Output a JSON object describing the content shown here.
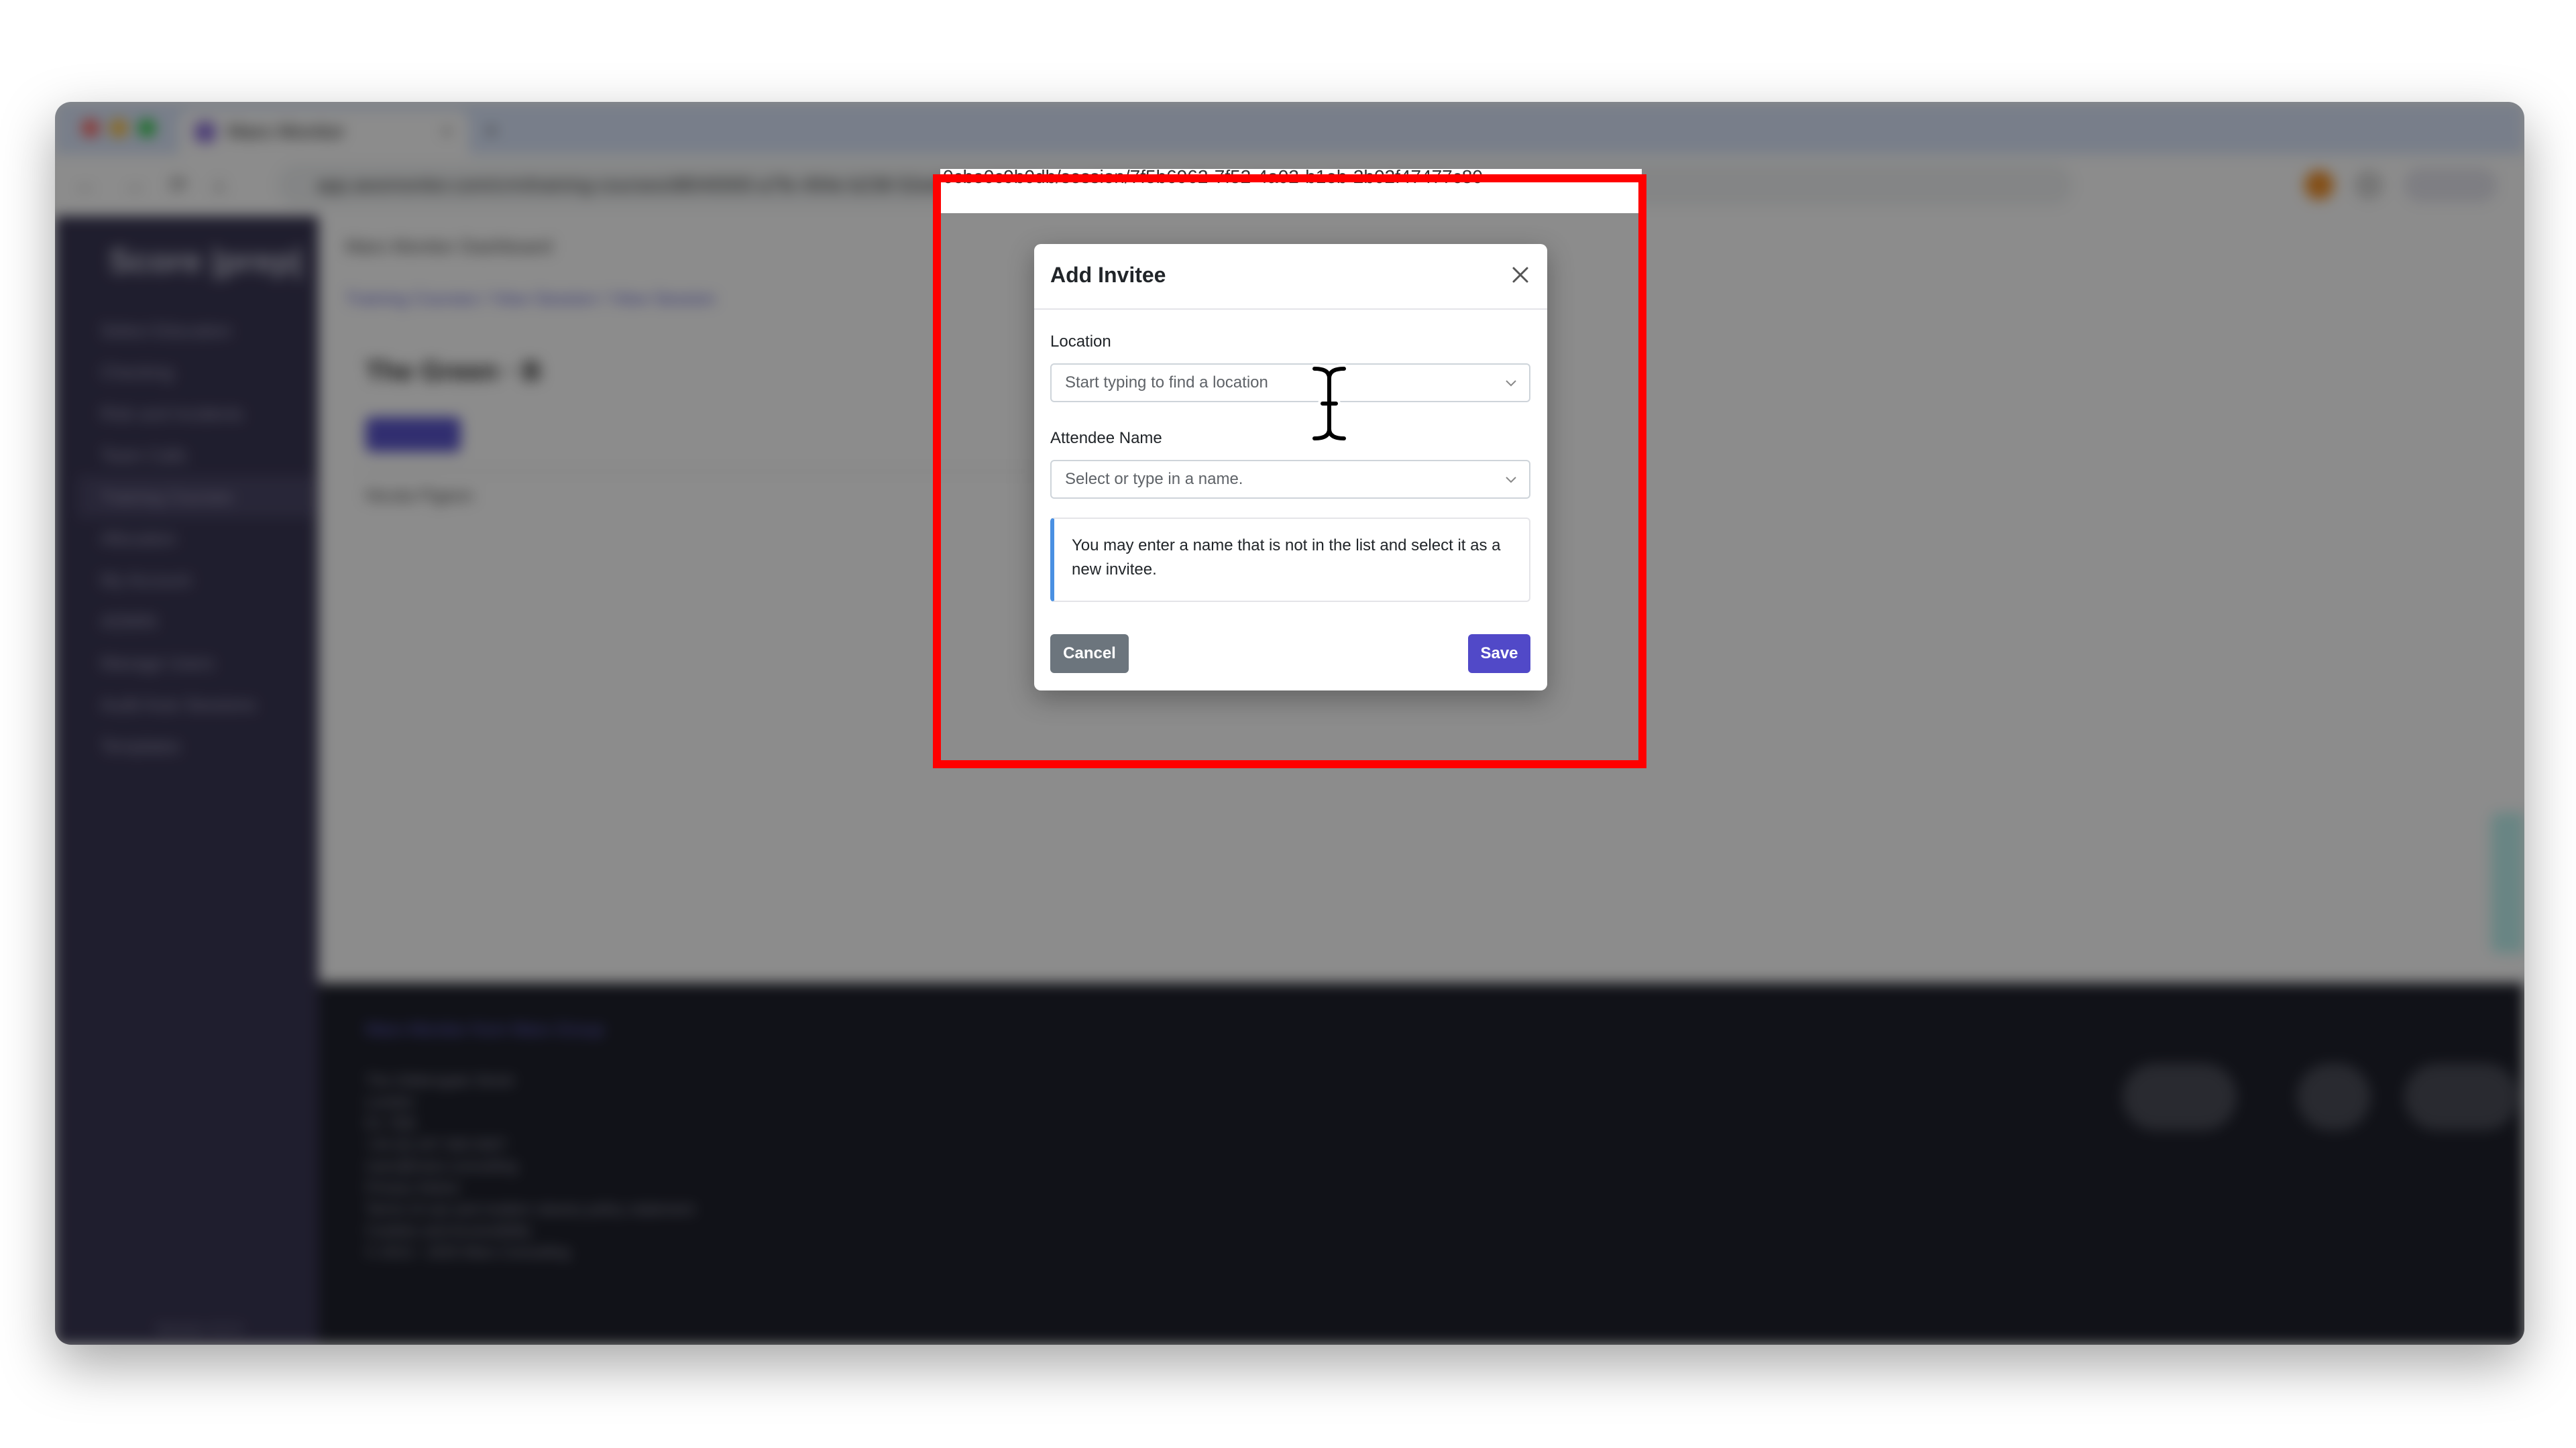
{
  "browser": {
    "tab_title": "Mars Monitor",
    "tab_close": "×",
    "new_tab": "+",
    "url_partial": "app.awsmonitor.com/crm/training-courses/d8040000-a7fe-494e-b238-52ed8c6de93c/session/70836e8e-7f92-4e02-b1eb-a90e7e9f93c6",
    "url_visible_tail": "0cbe0c9b0db/session/7f5b6962-7f52-4a02-b1eb-2b02f47477c80",
    "colors": {
      "tabstrip": "#dbe6fb",
      "close": "#ff5f57",
      "minimize": "#febc2e",
      "maximize": "#28c840"
    }
  },
  "sidebar": {
    "brand": "Score |prep|",
    "items": [
      {
        "label": "Select Education"
      },
      {
        "label": "Checking"
      },
      {
        "label": "Risk and Incidents"
      },
      {
        "label": "Team Calls"
      },
      {
        "label": "Training Courses"
      },
      {
        "label": "Allocation"
      },
      {
        "label": "My Account"
      },
      {
        "label": "ADMIN"
      },
      {
        "label": "Manage Users"
      },
      {
        "label": "Audit Auto Sessions"
      },
      {
        "label": "Templates"
      }
    ],
    "version": "Version 4.0.4",
    "bg_color": "#3a3754"
  },
  "main": {
    "header": "Mars Monitor Dashboard",
    "breadcrumb": "Training Courses  /  View Session  /  View Session",
    "title": "The Green · B",
    "add_button": "Add Invitee",
    "row_text": "Nicola Pigeon"
  },
  "footer": {
    "link": "Mars Monitor from Mars Group",
    "address": [
      "The Gildersgate Street",
      "London",
      "E1 7EB",
      "",
      "+44 (0) 207 000 0007",
      "mars@mars-consulting",
      "",
      "Privacy Notice",
      "Terms of use and modern slavery policy statement",
      "Cookies and Accessibility",
      "© 2013 - 2025 Mars Consulting"
    ]
  },
  "modal": {
    "title": "Add Invitee",
    "close_icon": "close-icon",
    "location_label": "Location",
    "location_placeholder": "Start typing to find a location",
    "attendee_label": "Attendee Name",
    "attendee_placeholder": "Select or type in a name.",
    "info_text": "You may enter a name that is not in the list and select it as a new invitee.",
    "cancel_label": "Cancel",
    "save_label": "Save",
    "colors": {
      "save": "#5149c8",
      "cancel": "#6c757d",
      "info_border": "#4a90e2"
    }
  },
  "annotation": {
    "highlight_color": "#ff0000"
  }
}
